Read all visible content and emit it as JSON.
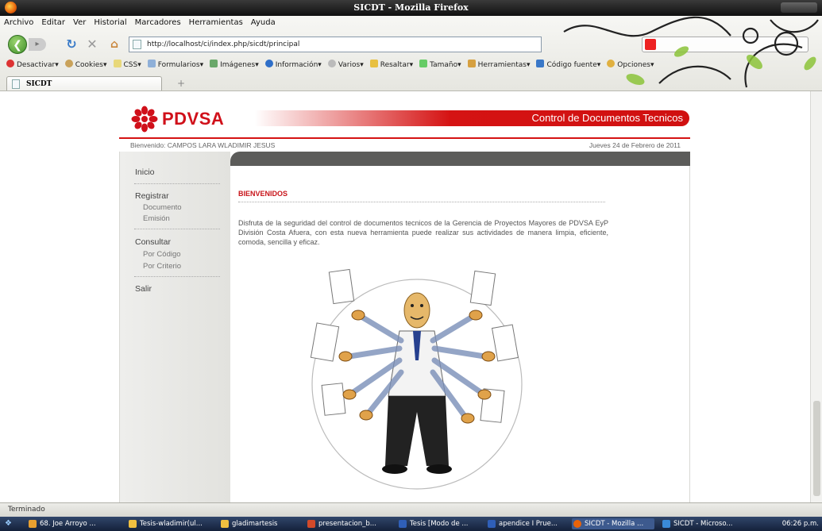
{
  "window": {
    "title": "SICDT - Mozilla Firefox"
  },
  "menu": [
    "Archivo",
    "Editar",
    "Ver",
    "Historial",
    "Marcadores",
    "Herramientas",
    "Ayuda"
  ],
  "address": {
    "url": "http://localhost/ci/index.php/sicdt/principal"
  },
  "devtoolbar": [
    "Desactivar",
    "Cookies",
    "CSS",
    "Formularios",
    "Imágenes",
    "Información",
    "Varios",
    "Resaltar",
    "Tamaño",
    "Herramientas",
    "Código fuente",
    "Opciones"
  ],
  "tab": {
    "label": "SICDT"
  },
  "header": {
    "brand": "PDVSA",
    "banner": "Control de Documentos Tecnicos"
  },
  "user": {
    "welcome": "Bienvenido: CAMPOS LARA WLADIMIR JESUS",
    "date": "Jueves 24 de Febrero de 2011"
  },
  "sidebar": {
    "inicio": "Inicio",
    "registrar": "Registrar",
    "documento": "Documento",
    "emision": "Emisión",
    "consultar": "Consultar",
    "por_codigo": "Por Código",
    "por_criterio": "Por Criterio",
    "salir": "Salir"
  },
  "main": {
    "heading": "BIENVENIDOS",
    "text": "Disfruta de la seguridad del control de documentos tecnicos de la Gerencia de Proyectos Mayores de PDVSA EyP División Costa Afuera, con esta nueva herramienta puede realizar sus actividades de manera limpia, eficiente, comoda, sencilla y eficaz."
  },
  "status": {
    "text": "Terminado"
  },
  "taskbar": {
    "items": [
      "68. Joe Arroyo ...",
      "Tesis-wladimir(ul...",
      "gladimartesis",
      "presentacion_b...",
      "Tesis [Modo de ...",
      "apendice I Prue...",
      "SICDT - Mozilla ...",
      "SICDT - Microso..."
    ],
    "clock": "06:26 p.m."
  },
  "colors": {
    "brand_red": "#d51313",
    "sidebar_bg": "#e8e8e5",
    "content_tab": "#5c5c5a"
  }
}
